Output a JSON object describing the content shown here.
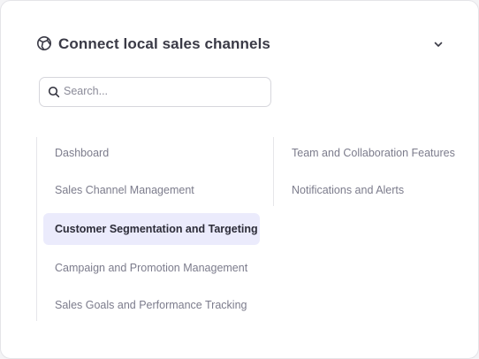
{
  "header": {
    "title": "Connect local sales channels",
    "icon": "globe-icon",
    "toggle_icon": "chevron-down-icon"
  },
  "search": {
    "placeholder": "Search...",
    "value": "",
    "icon": "search-icon"
  },
  "colors": {
    "active_background": "#ebebfc",
    "text_muted": "#7c7c8c",
    "text_strong": "#2c2c38"
  },
  "menu": {
    "left": [
      {
        "label": "Dashboard",
        "active": false
      },
      {
        "label": "Sales Channel Management",
        "active": false
      },
      {
        "label": "Customer Segmentation and Targeting",
        "active": true
      },
      {
        "label": "Campaign and Promotion Management",
        "active": false
      },
      {
        "label": "Sales Goals and Performance Tracking",
        "active": false
      }
    ],
    "right": [
      {
        "label": "Team and Collaboration Features",
        "active": false
      },
      {
        "label": "Notifications and Alerts",
        "active": false
      }
    ]
  }
}
